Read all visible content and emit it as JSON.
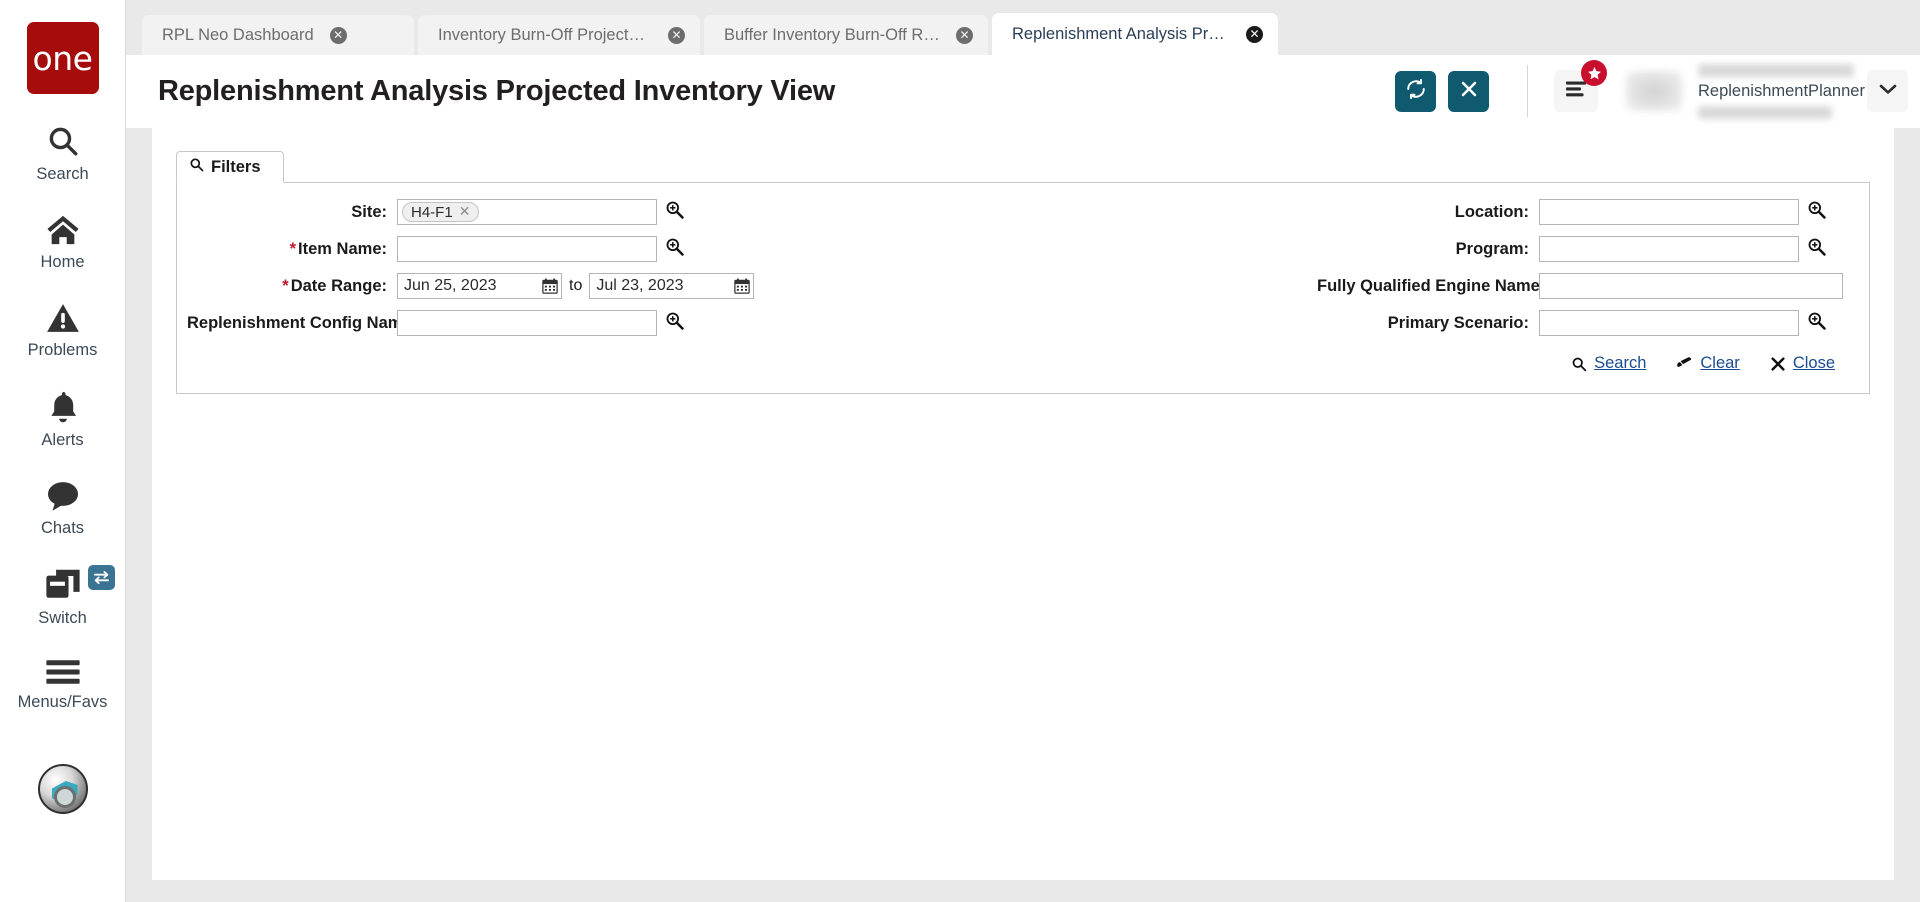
{
  "brand": {
    "logo_text": "one"
  },
  "sidebar": {
    "items": [
      {
        "label": "Search",
        "icon": "search-icon"
      },
      {
        "label": "Home",
        "icon": "home-icon"
      },
      {
        "label": "Problems",
        "icon": "warning-triangle-icon"
      },
      {
        "label": "Alerts",
        "icon": "bell-icon"
      },
      {
        "label": "Chats",
        "icon": "chat-bubble-icon"
      },
      {
        "label": "Switch",
        "icon": "windows-stack-icon",
        "badge_icon": "swap-arrows-icon"
      },
      {
        "label": "Menus/Favs",
        "icon": "hamburger-icon"
      }
    ],
    "avatar": {
      "name": "user-avatar-orb"
    }
  },
  "tabs": [
    {
      "label": "RPL Neo Dashboard",
      "active": false
    },
    {
      "label": "Inventory Burn-Off Projected Inv...",
      "active": false
    },
    {
      "label": "Buffer Inventory Burn-Off Report",
      "active": false
    },
    {
      "label": "Replenishment Analysis Projecte...",
      "active": true
    }
  ],
  "header": {
    "title": "Replenishment Analysis Projected Inventory View",
    "refresh_icon": "refresh-icon",
    "close_icon": "close-x-icon",
    "menu_icon": "list-menu-icon",
    "star_badge_icon": "star-icon",
    "caret_icon": "chevron-down-icon"
  },
  "user": {
    "role": "ReplenishmentPlanner"
  },
  "filters": {
    "tab_label": "Filters",
    "tab_icon": "search-icon",
    "fields": {
      "site": {
        "label": "Site:",
        "required": false,
        "chips": [
          "H4-F1"
        ],
        "placeholder": "",
        "lookup_icon": "magnifier-plus-icon"
      },
      "item_name": {
        "label": "Item Name:",
        "required": true,
        "value": "",
        "placeholder": "",
        "lookup_icon": "magnifier-plus-icon"
      },
      "date_range": {
        "label": "Date Range:",
        "required": true,
        "from": "Jun 25, 2023",
        "to_label": "to",
        "to": "Jul 23, 2023",
        "calendar_icon": "calendar-icon"
      },
      "replenishment_config_name": {
        "label": "Replenishment Config Name:",
        "required": false,
        "value": "",
        "placeholder": "",
        "lookup_icon": "magnifier-plus-icon"
      },
      "location": {
        "label": "Location:",
        "required": false,
        "value": "",
        "placeholder": "",
        "lookup_icon": "magnifier-plus-icon"
      },
      "program": {
        "label": "Program:",
        "required": false,
        "value": "",
        "placeholder": "",
        "lookup_icon": "magnifier-plus-icon"
      },
      "fully_qualified_engine_name": {
        "label": "Fully Qualified Engine Name:",
        "required": false,
        "value": "",
        "placeholder": ""
      },
      "primary_scenario": {
        "label": "Primary Scenario:",
        "required": false,
        "value": "",
        "placeholder": "",
        "lookup_icon": "magnifier-plus-icon"
      }
    },
    "actions": {
      "search": {
        "label": "Search",
        "icon": "search-icon"
      },
      "clear": {
        "label": "Clear",
        "icon": "eraser-icon"
      },
      "close": {
        "label": "Close",
        "icon": "x-icon"
      }
    }
  },
  "colors": {
    "brand_red": "#a60c0c",
    "teal_button": "#0f5a6e",
    "badge_red": "#c8102e",
    "link_blue": "#1a4c8f",
    "required_red": "#c0152f",
    "switch_badge_blue": "#3b7392"
  }
}
